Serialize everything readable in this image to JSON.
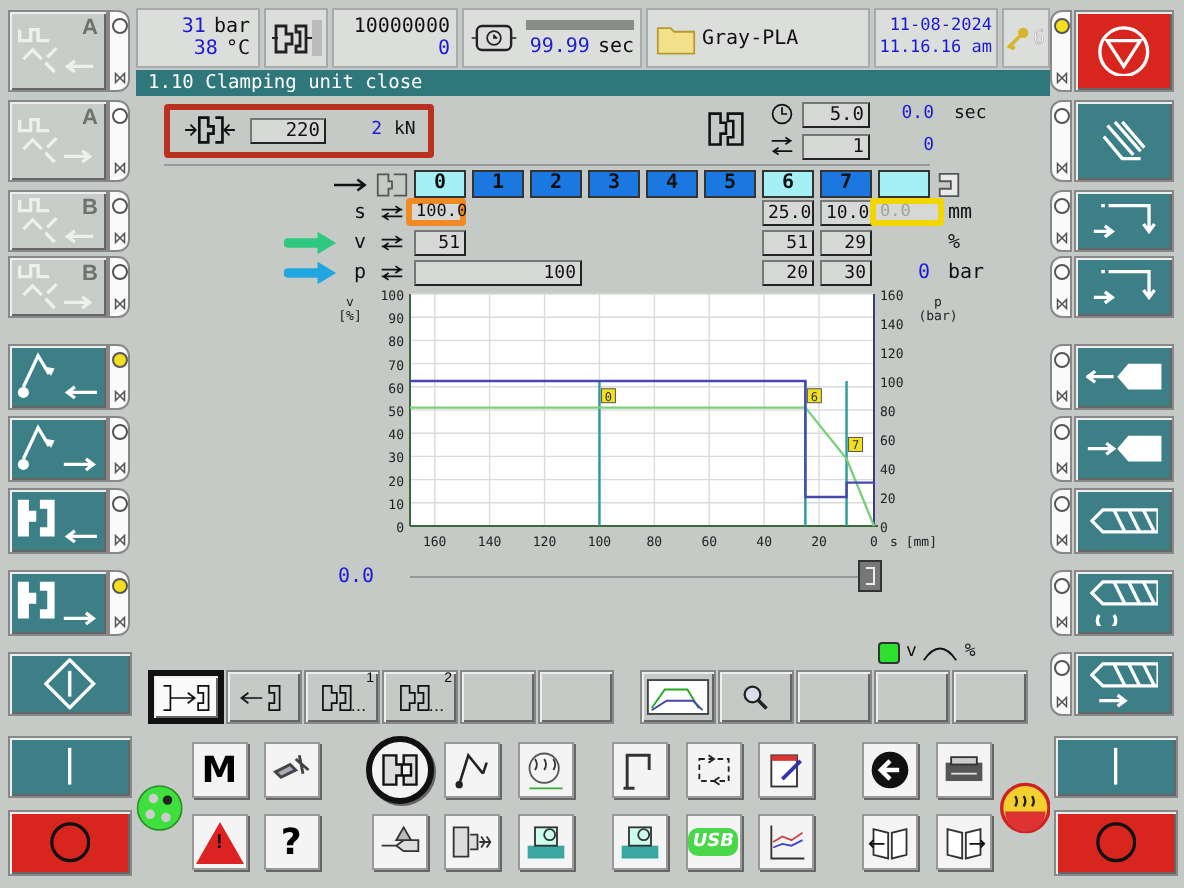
{
  "left_buttons": [
    {
      "kind": "gray",
      "label": "A",
      "lamp": false
    },
    {
      "kind": "gray",
      "label": "A",
      "lamp": false
    },
    {
      "kind": "gray",
      "label": "B",
      "lamp": false
    },
    {
      "kind": "gray",
      "label": "B",
      "lamp": false
    },
    {
      "kind": "teal",
      "lamp": true
    },
    {
      "kind": "teal",
      "lamp": false
    },
    {
      "kind": "teal",
      "lamp": false
    },
    {
      "kind": "teal",
      "lamp": true
    },
    {
      "kind": "teal"
    },
    {
      "kind": "teal"
    },
    {
      "kind": "red"
    }
  ],
  "right_buttons": [
    {
      "kind": "red",
      "lamp": true
    },
    {
      "kind": "teal",
      "lamp": false
    },
    {
      "kind": "teal",
      "lamp": false
    },
    {
      "kind": "teal",
      "lamp": false
    },
    {
      "kind": "teal",
      "lamp": false
    },
    {
      "kind": "teal",
      "lamp": false
    },
    {
      "kind": "teal",
      "lamp": false
    },
    {
      "kind": "teal",
      "lamp": false
    },
    {
      "kind": "teal",
      "lamp": false
    },
    {
      "kind": "teal"
    },
    {
      "kind": "red"
    }
  ],
  "header": {
    "pressure": "31",
    "pressure_unit": "bar",
    "temperature": "38",
    "temperature_unit": "°C",
    "counter_target": "10000000",
    "counter_value": "0",
    "cycle_time": "99.99",
    "cycle_unit": "sec",
    "cycle_bar": {
      "level": 1
    },
    "mold_name": "Gray-PLA",
    "date": "11-08-2024",
    "time": "11.16.16 am",
    "access_level": "6"
  },
  "title": "1.10 Clamping unit close",
  "clamp_force": {
    "setpoint": "220",
    "actual": "2",
    "unit": "kN",
    "color": "#b8321e"
  },
  "timer": {
    "time_set": "5.0",
    "time_actual": "0.0",
    "time_unit": "sec",
    "count_set": "1",
    "count_actual": "0"
  },
  "stages": [
    {
      "label": "0",
      "highlighted": true
    },
    {
      "label": "1",
      "highlighted": false
    },
    {
      "label": "2",
      "highlighted": false
    },
    {
      "label": "3",
      "highlighted": false
    },
    {
      "label": "4",
      "highlighted": false
    },
    {
      "label": "5",
      "highlighted": false
    },
    {
      "label": "6",
      "highlighted": true
    },
    {
      "label": "7",
      "highlighted": false
    },
    {
      "highlighted": true
    }
  ],
  "profile_rows": [
    {
      "symbol": "s",
      "unit": "mm",
      "cells": [
        {
          "text": "100.0",
          "color": "#f08a24",
          "disabled": false
        },
        {
          "text": "25.0",
          "disabled": false
        },
        {
          "text": "10.0",
          "disabled": false
        },
        {
          "text": "0.0",
          "color": "#f2d600",
          "disabled": true
        }
      ]
    },
    {
      "symbol": "v",
      "color": "#2ec87e",
      "unit": "%",
      "cells": [
        {
          "text": "51",
          "disabled": false
        },
        {
          "text": "51",
          "disabled": false
        },
        {
          "text": "29",
          "disabled": false
        }
      ]
    },
    {
      "symbol": "p",
      "color": "#22a6e0",
      "unit": "bar",
      "reading": "0",
      "cells": [
        {
          "text": "100",
          "disabled": false
        },
        {
          "text": "20",
          "disabled": false
        },
        {
          "text": "30",
          "disabled": false
        }
      ]
    }
  ],
  "chart_data": {
    "type": "line",
    "ylabel": "v\n[%]",
    "y2label": "p\n(bar)",
    "xlabel": "s [mm]",
    "x": [
      169,
      100,
      25,
      25,
      10,
      10,
      0
    ],
    "xlim": [
      169,
      0
    ],
    "ylim": [
      0,
      100
    ],
    "y2lim": [
      0,
      160
    ],
    "xticks": [
      160,
      140,
      120,
      100,
      80,
      60,
      40,
      20,
      0
    ],
    "yticks": [
      0,
      10,
      20,
      30,
      40,
      50,
      60,
      70,
      80,
      90,
      100
    ],
    "y2ticks": [
      0,
      20,
      40,
      60,
      80,
      100,
      120,
      140,
      160
    ],
    "series": [
      {
        "color": "#7ccf7c",
        "values": [
          51,
          51,
          51,
          51,
          29,
          29,
          0
        ]
      },
      {
        "color": "#4848b0",
        "axis": "y2",
        "values": [
          100,
          100,
          100,
          20,
          20,
          30,
          30
        ]
      }
    ],
    "grid": true,
    "ref_lines": [
      {
        "axis": "x",
        "value": 100,
        "color": "#2a9a9a"
      },
      {
        "axis": "x",
        "value": 25,
        "color": "#2a9a9a"
      },
      {
        "axis": "x",
        "value": 10,
        "color": "#2a9a9a"
      }
    ],
    "annotations": [
      {
        "x": 100,
        "y": 54,
        "text": "0"
      },
      {
        "x": 25,
        "y": 54,
        "text": "6"
      },
      {
        "x": 10,
        "y": 33,
        "text": "7"
      }
    ]
  },
  "position": {
    "value": "0.0",
    "level": 1
  },
  "monitor": {
    "on": true,
    "label_v": "v",
    "label_unit": "%"
  },
  "function_buttons": [
    {
      "kind": "close",
      "selected": true
    },
    {
      "kind": "open",
      "selected": false
    },
    {
      "kind": "program",
      "superscript": "1",
      "selected": false
    },
    {
      "kind": "program",
      "superscript": "2",
      "selected": false
    },
    {
      "kind": "empty",
      "selected": false
    },
    {
      "kind": "empty",
      "selected": false
    },
    {
      "kind": "chart",
      "selected": false
    },
    {
      "kind": "search",
      "selected": false
    },
    {
      "kind": "empty",
      "selected": false
    },
    {
      "kind": "empty",
      "selected": false
    },
    {
      "kind": "empty",
      "selected": false
    }
  ],
  "menu_icons": [
    [
      {
        "kind": "text",
        "label": "M",
        "selected": false
      },
      {
        "kind": "icon",
        "selected": false
      },
      {
        "kind": "icon",
        "selected": true
      },
      {
        "kind": "icon",
        "selected": false
      },
      {
        "kind": "icon",
        "selected": false
      },
      {
        "kind": "icon",
        "selected": false
      },
      {
        "kind": "icon",
        "selected": false
      },
      {
        "kind": "icon",
        "selected": false
      },
      {
        "kind": "icon",
        "selected": false
      },
      {
        "kind": "icon",
        "selected": false
      }
    ],
    [
      {
        "kind": "warning",
        "label": "!",
        "selected": false
      },
      {
        "kind": "text",
        "label": "?",
        "selected": false
      },
      {
        "kind": "icon",
        "selected": false
      },
      {
        "kind": "icon",
        "selected": false
      },
      {
        "kind": "icon",
        "selected": false
      },
      {
        "kind": "icon",
        "selected": false
      },
      {
        "kind": "usb",
        "label": "USB",
        "selected": false
      },
      {
        "kind": "icon",
        "selected": false
      },
      {
        "kind": "icon",
        "selected": false
      },
      {
        "kind": "icon",
        "selected": false
      }
    ]
  ]
}
